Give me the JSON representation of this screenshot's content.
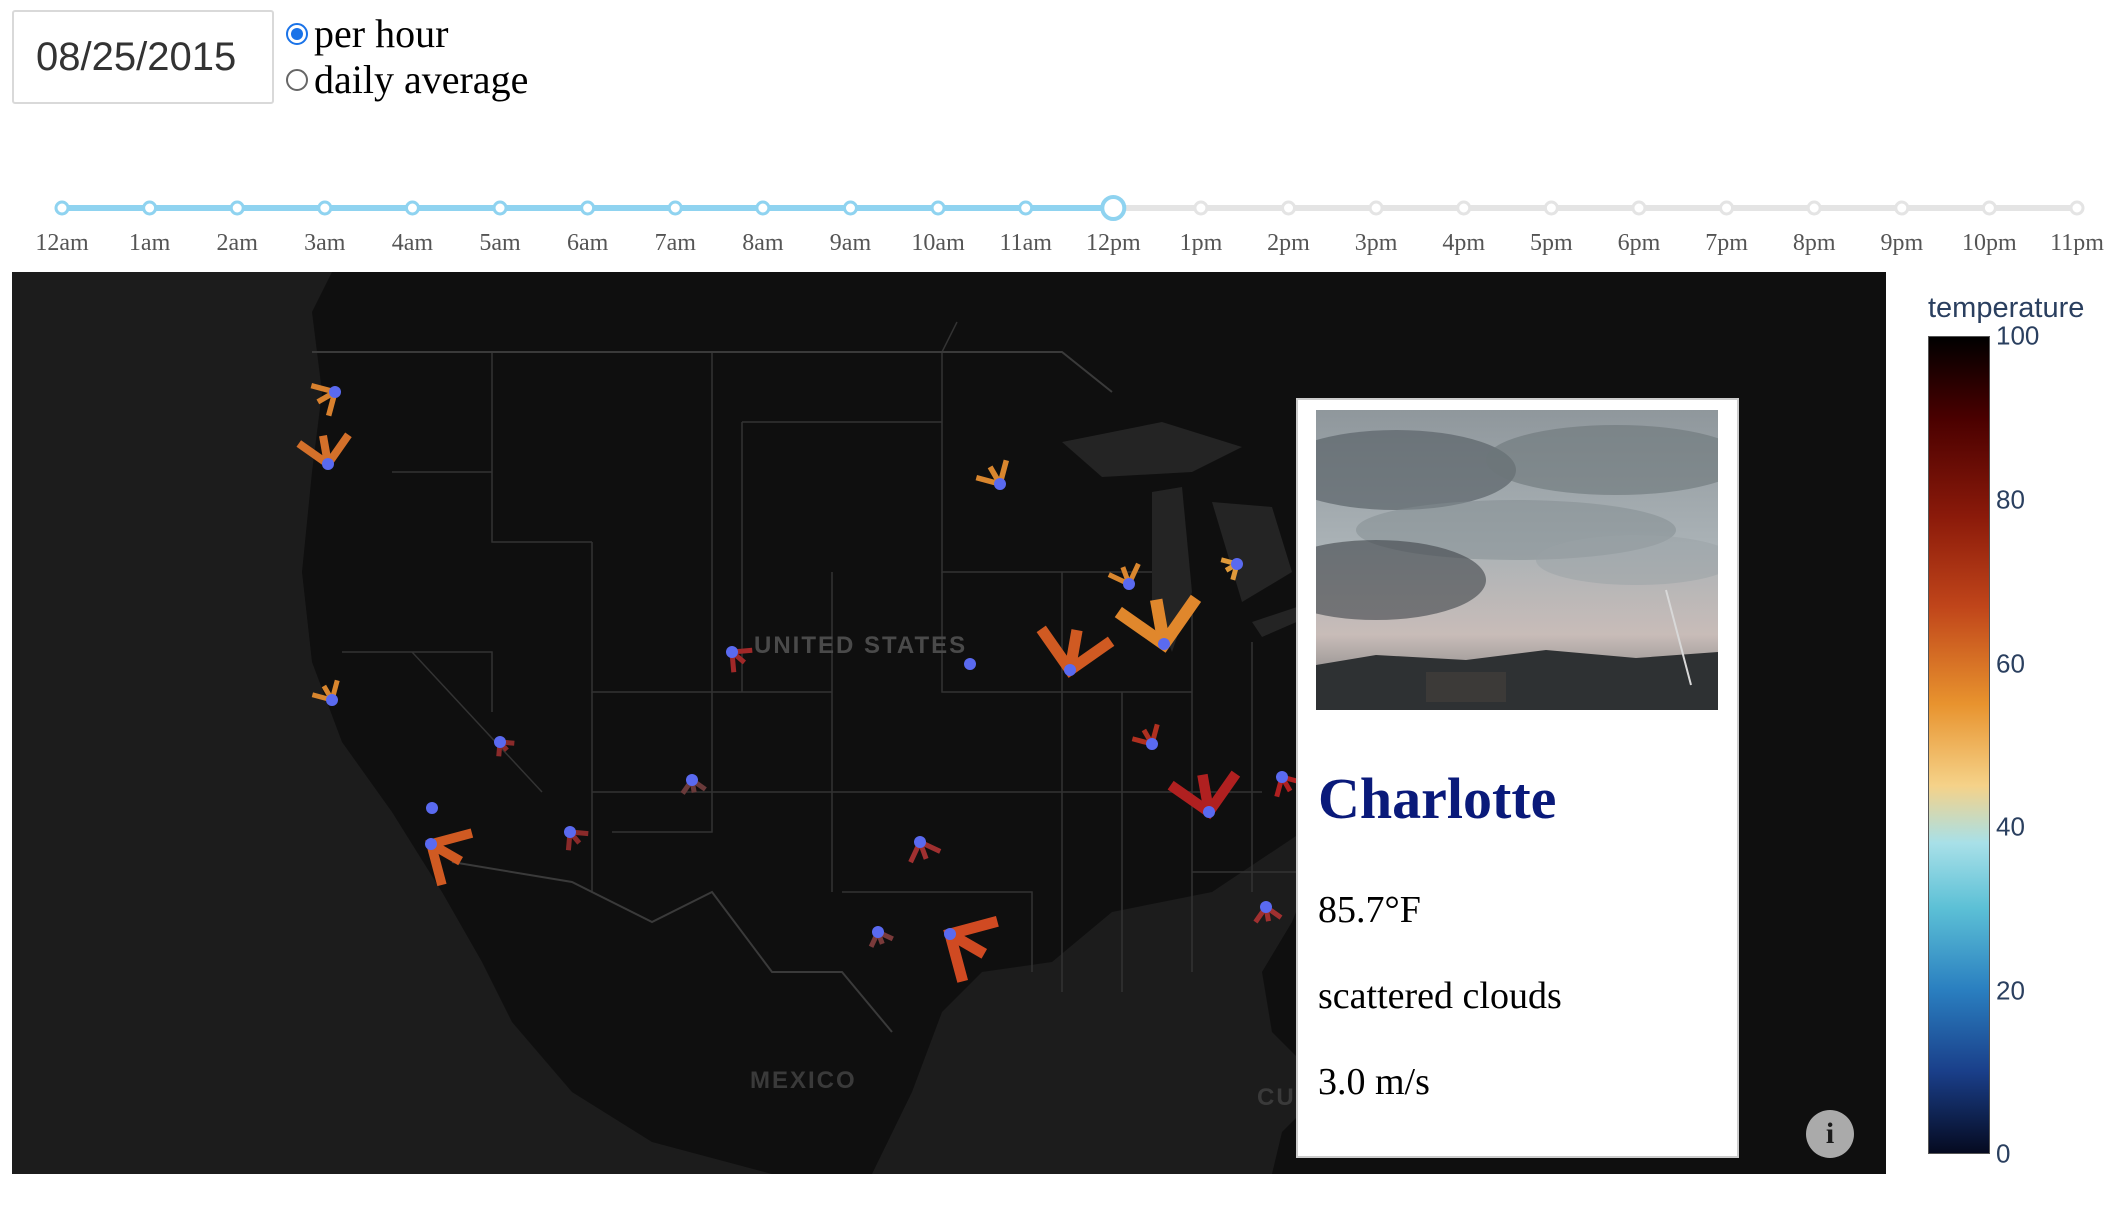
{
  "date_input": {
    "value": "08/25/2015"
  },
  "mode": {
    "options": [
      "per hour",
      "daily average"
    ],
    "selected": "per hour"
  },
  "timeline": {
    "labels": [
      "12am",
      "1am",
      "2am",
      "3am",
      "4am",
      "5am",
      "6am",
      "7am",
      "8am",
      "9am",
      "10am",
      "11am",
      "12pm",
      "1pm",
      "2pm",
      "3pm",
      "4pm",
      "5pm",
      "6pm",
      "7pm",
      "8pm",
      "9pm",
      "10pm",
      "11pm"
    ],
    "selected_index": 12,
    "active_color": "#8fd3f0",
    "inactive_color": "#e4e4e4"
  },
  "map": {
    "country_labels": [
      "UNITED STATES",
      "MEXICO",
      "CUE"
    ],
    "background_color": "#1a1a1a"
  },
  "popup": {
    "city": "Charlotte",
    "temperature": "85.7°F",
    "conditions": "scattered clouds",
    "wind_speed": "3.0 m/s"
  },
  "legend": {
    "title": "temperature",
    "ticks": [
      "100",
      "80",
      "60",
      "40",
      "20",
      "0"
    ]
  }
}
